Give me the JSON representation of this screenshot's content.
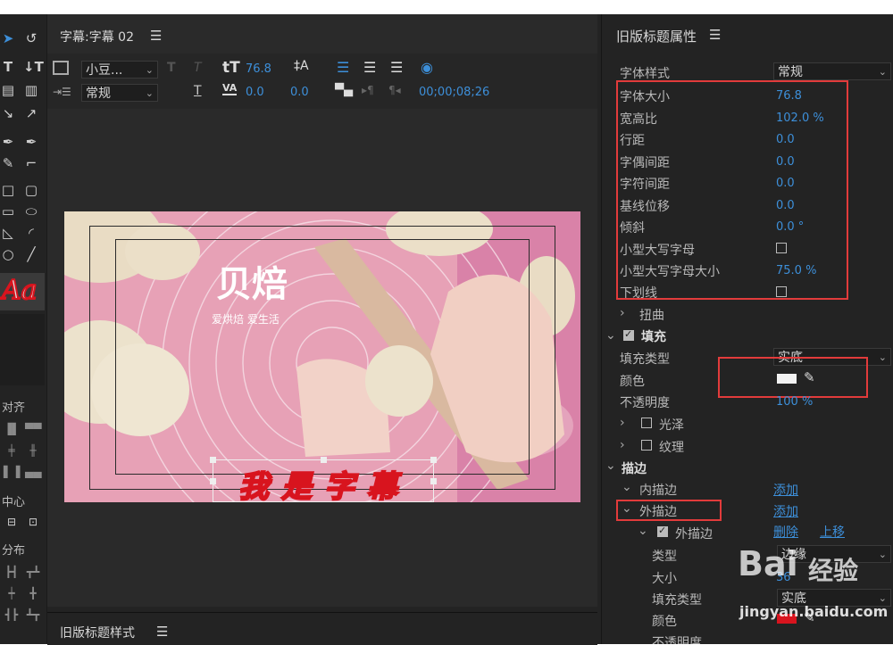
{
  "titler": {
    "tab_title": "字幕:字幕 02",
    "font_family": "小豆...",
    "font_style": "常规",
    "font_size": "76.8",
    "kerning": "0.0",
    "leading": "0.0",
    "timecode": "00;00;08;26",
    "caption_text": "我是字幕",
    "logo_text": "贝焙",
    "logo_slogan": "爱烘焙 爱生活"
  },
  "tools": {
    "align_label": "对齐",
    "center_label": "中心",
    "distribute_label": "分布",
    "sample_text": "Aa"
  },
  "props": {
    "title": "旧版标题属性",
    "rows": [
      {
        "label": "字体样式",
        "value": "常规"
      },
      {
        "label": "字体大小",
        "value": "76.8"
      },
      {
        "label": "宽高比",
        "value": "102.0 %"
      },
      {
        "label": "行距",
        "value": "0.0"
      },
      {
        "label": "字偶间距",
        "value": "0.0"
      },
      {
        "label": "字符间距",
        "value": "0.0"
      },
      {
        "label": "基线位移",
        "value": "0.0"
      },
      {
        "label": "倾斜",
        "value": "0.0 °"
      },
      {
        "label": "小型大写字母",
        "value": ""
      },
      {
        "label": "小型大写字母大小",
        "value": "75.0 %"
      },
      {
        "label": "下划线",
        "value": ""
      }
    ],
    "distort": "扭曲",
    "fill": "填充",
    "fill_type_label": "填充类型",
    "fill_type_value": "实底",
    "color_label": "颜色",
    "opacity_label": "不透明度",
    "opacity_value": "100 %",
    "gloss": "光泽",
    "texture": "纹理",
    "stroke": "描边",
    "inner_stroke": "内描边",
    "outer_stroke": "外描边",
    "add": "添加",
    "delete": "删除",
    "move_up": "上移",
    "outer_stroke_item": "外描边",
    "type_label": "类型",
    "type_value": "边缘",
    "size_label": "大小",
    "size_value": "36",
    "fill_type2_label": "填充类型",
    "fill_type2_value": "实底",
    "color2_label": "颜色",
    "opacity2_label": "不透明度"
  },
  "bottom": {
    "title": "旧版标题样式"
  },
  "watermark": {
    "brand": "Bai",
    "brand2": "经验",
    "url": "jingyan.baidu.com"
  },
  "colors": {
    "accent": "#3d8fd9",
    "highlight": "#e23b3b",
    "caption_red": "#d8141e"
  }
}
